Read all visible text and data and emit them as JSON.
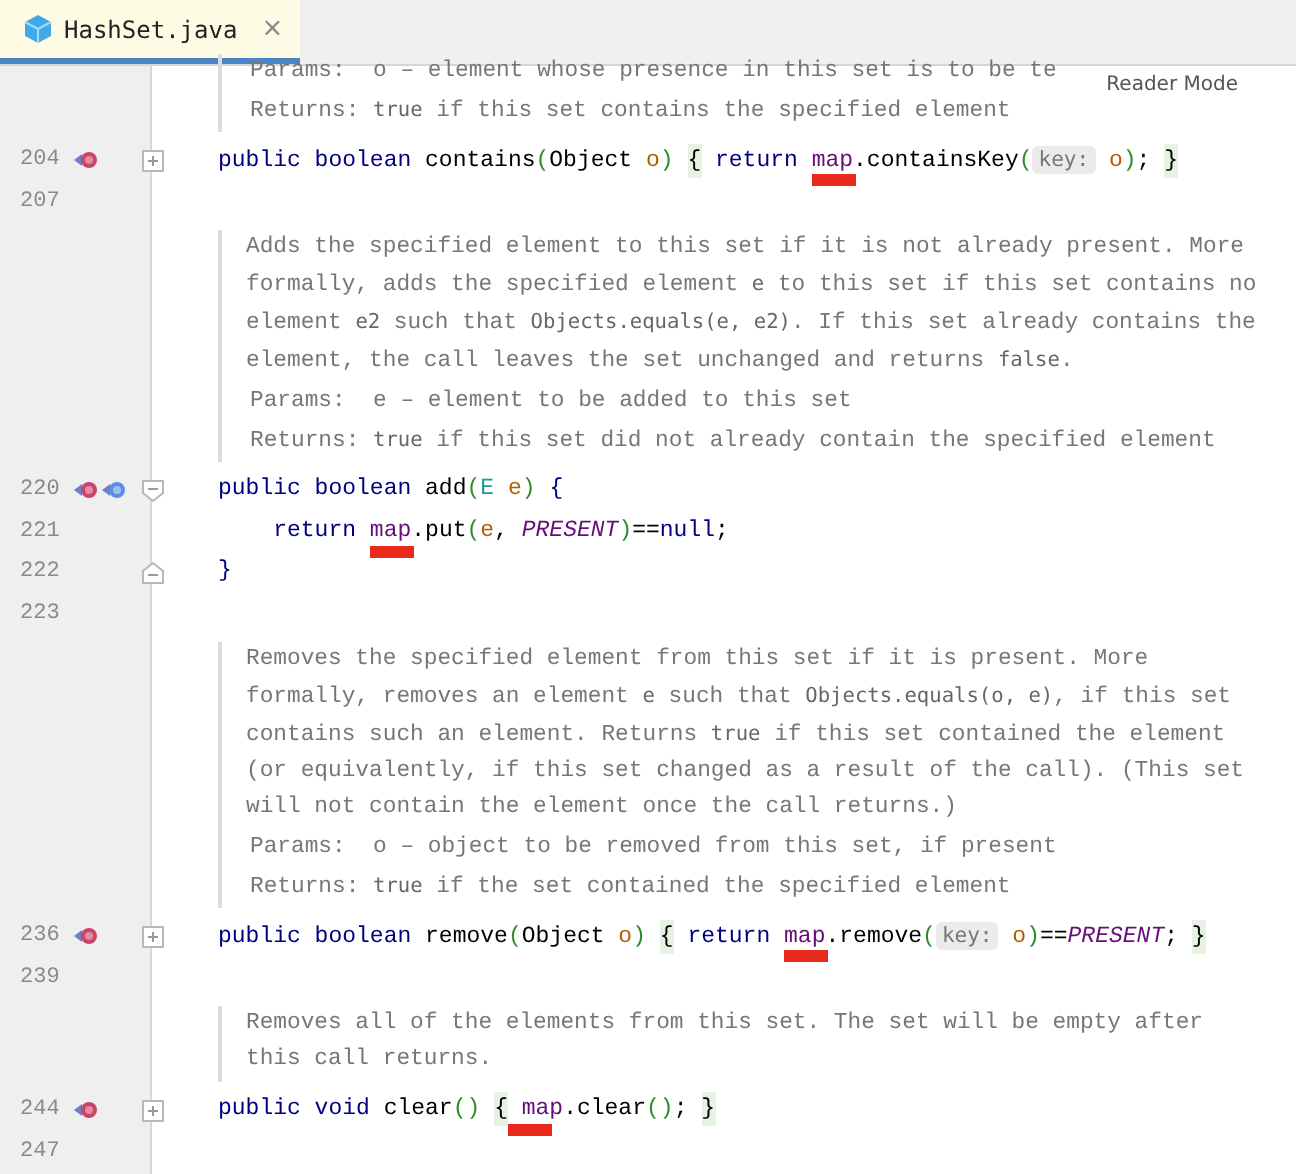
{
  "tab": {
    "title": "HashSet.java",
    "close": "×",
    "selected": true
  },
  "reader_mode": "Reader Mode",
  "rows": [
    {
      "kind": "doc",
      "lines": [],
      "tags": [
        {
          "label": "Params:",
          "segments": [
            {
              "t": " o – element whose presence in this set is to be te"
            }
          ]
        },
        {
          "label": "Returns:",
          "segments": [
            {
              "t": "true",
              "code": true
            },
            {
              "t": " if this set contains the specified element"
            }
          ]
        }
      ]
    },
    {
      "kind": "code",
      "number": "204",
      "icons": [
        {
          "kind": "overrides"
        }
      ],
      "fold_marker": {
        "kind": "collapsed"
      },
      "tokens": [
        {
          "t": "public boolean ",
          "color": "#000080"
        },
        {
          "t": "contains",
          "color": "#000000"
        },
        {
          "t": "(",
          "color": "#2f8c2f"
        },
        {
          "t": "Object ",
          "color": "#000000"
        },
        {
          "t": "o",
          "color": "#b35c00"
        },
        {
          "t": ") ",
          "color": "#2f8c2f"
        },
        {
          "t": "{",
          "kind": "fold"
        },
        {
          "t": " return ",
          "color": "#000080"
        },
        {
          "t": "map",
          "color": "#660e7a",
          "marked": true
        },
        {
          "t": ".containsKey",
          "color": "#000000"
        },
        {
          "t": "(",
          "color": "#2f8c2f"
        },
        {
          "t": "key:",
          "kind": "hint"
        },
        {
          "t": " o",
          "color": "#b35c00"
        },
        {
          "t": ")",
          "color": "#2f8c2f"
        },
        {
          "t": "; ",
          "color": "#000000"
        },
        {
          "t": "}",
          "kind": "fold"
        }
      ]
    },
    {
      "kind": "code",
      "number": "207"
    },
    {
      "kind": "doc",
      "lines": [
        [
          {
            "t": "Adds the specified element to this set if it is not already present. More"
          }
        ],
        [
          {
            "t": "formally, adds the specified element "
          },
          {
            "t": "e",
            "code": true
          },
          {
            "t": " to this set if this set contains no"
          }
        ],
        [
          {
            "t": "element "
          },
          {
            "t": "e2",
            "code": true
          },
          {
            "t": " such that "
          },
          {
            "t": "Objects.equals(e, e2)",
            "code": true
          },
          {
            "t": ". If this set already contains the"
          }
        ],
        [
          {
            "t": "element, the call leaves the set unchanged and returns "
          },
          {
            "t": "false",
            "code": true
          },
          {
            "t": "."
          }
        ]
      ],
      "tags": [
        {
          "label": "Params:",
          "segments": [
            {
              "t": " e – element to be added to this set"
            }
          ]
        },
        {
          "label": "Returns:",
          "segments": [
            {
              "t": "true",
              "code": true
            },
            {
              "t": " if this set did not already contain the specified element"
            }
          ]
        }
      ]
    },
    {
      "kind": "code",
      "number": "220",
      "icons": [
        {
          "kind": "overrides"
        },
        {
          "kind": "overridden"
        }
      ],
      "fold_marker": {
        "kind": "expanded"
      },
      "tokens": [
        {
          "t": "public boolean ",
          "color": "#000080"
        },
        {
          "t": "add",
          "color": "#000000"
        },
        {
          "t": "(",
          "color": "#2f8c2f"
        },
        {
          "t": "E ",
          "color": "#20999d"
        },
        {
          "t": "e",
          "color": "#b35c00"
        },
        {
          "t": ") ",
          "color": "#2f8c2f"
        },
        {
          "t": "{",
          "color": "#000080"
        }
      ]
    },
    {
      "kind": "code",
      "number": "221",
      "tokens": [
        {
          "t": "    return ",
          "color": "#000080"
        },
        {
          "t": "map",
          "color": "#660e7a",
          "marked": true
        },
        {
          "t": ".put",
          "color": "#000000"
        },
        {
          "t": "(",
          "color": "#2f8c2f"
        },
        {
          "t": "e",
          "color": "#b35c00"
        },
        {
          "t": ", ",
          "color": "#000000"
        },
        {
          "t": "PRESENT",
          "color": "#660e7a",
          "italic": true
        },
        {
          "t": ")",
          "color": "#2f8c2f"
        },
        {
          "t": "==",
          "color": "#000000"
        },
        {
          "t": "null",
          "color": "#000080"
        },
        {
          "t": ";",
          "color": "#000000"
        }
      ]
    },
    {
      "kind": "code",
      "number": "222",
      "fold_marker": {
        "kind": "end"
      },
      "tokens": [
        {
          "t": "}",
          "color": "#000080"
        }
      ]
    },
    {
      "kind": "code",
      "number": "223"
    },
    {
      "kind": "doc",
      "lines": [
        [
          {
            "t": "Removes the specified element from this set if it is present. More"
          }
        ],
        [
          {
            "t": "formally, removes an element "
          },
          {
            "t": "e",
            "code": true
          },
          {
            "t": " such that "
          },
          {
            "t": "Objects.equals(o, e)",
            "code": true
          },
          {
            "t": ", if this set"
          }
        ],
        [
          {
            "t": "contains such an element. Returns "
          },
          {
            "t": "true",
            "code": true
          },
          {
            "t": " if this set contained the element"
          }
        ],
        [
          {
            "t": "(or equivalently, if this set changed as a result of the call). (This set"
          }
        ],
        [
          {
            "t": "will not contain the element once the call returns.)"
          }
        ]
      ],
      "tags": [
        {
          "label": "Params:",
          "segments": [
            {
              "t": " o – object to be removed from this set, if present"
            }
          ]
        },
        {
          "label": "Returns:",
          "segments": [
            {
              "t": "true",
              "code": true
            },
            {
              "t": " if the set contained the specified element"
            }
          ]
        }
      ]
    },
    {
      "kind": "code",
      "number": "236",
      "icons": [
        {
          "kind": "overrides"
        }
      ],
      "fold_marker": {
        "kind": "collapsed"
      },
      "tokens": [
        {
          "t": "public boolean ",
          "color": "#000080"
        },
        {
          "t": "remove",
          "color": "#000000"
        },
        {
          "t": "(",
          "color": "#2f8c2f"
        },
        {
          "t": "Object ",
          "color": "#000000"
        },
        {
          "t": "o",
          "color": "#b35c00"
        },
        {
          "t": ") ",
          "color": "#2f8c2f"
        },
        {
          "t": "{",
          "kind": "fold"
        },
        {
          "t": " return ",
          "color": "#000080"
        },
        {
          "t": "map",
          "color": "#660e7a",
          "marked": true
        },
        {
          "t": ".remove",
          "color": "#000000"
        },
        {
          "t": "(",
          "color": "#2f8c2f"
        },
        {
          "t": "key:",
          "kind": "hint"
        },
        {
          "t": " o",
          "color": "#b35c00"
        },
        {
          "t": ")",
          "color": "#2f8c2f"
        },
        {
          "t": "==",
          "color": "#000000"
        },
        {
          "t": "PRESENT",
          "color": "#660e7a",
          "italic": true
        },
        {
          "t": "; ",
          "color": "#000000"
        },
        {
          "t": "}",
          "kind": "fold"
        }
      ]
    },
    {
      "kind": "code",
      "number": "239"
    },
    {
      "kind": "doc",
      "lines": [
        [
          {
            "t": "Removes all of the elements from this set. The set will be empty after"
          }
        ],
        [
          {
            "t": "this call returns."
          }
        ]
      ],
      "tags": []
    },
    {
      "kind": "code",
      "number": "244",
      "icons": [
        {
          "kind": "overrides"
        }
      ],
      "fold_marker": {
        "kind": "collapsed"
      },
      "tokens": [
        {
          "t": "public void ",
          "color": "#000080"
        },
        {
          "t": "clear",
          "color": "#000000"
        },
        {
          "t": "() ",
          "color": "#2f8c2f"
        },
        {
          "t": "{",
          "kind": "fold"
        },
        {
          "t": " map",
          "color": "#660e7a",
          "marked": true
        },
        {
          "t": ".clear",
          "color": "#000000"
        },
        {
          "t": "()",
          "color": "#2f8c2f"
        },
        {
          "t": "; ",
          "color": "#000000"
        },
        {
          "t": "}",
          "kind": "fold"
        }
      ]
    },
    {
      "kind": "code",
      "number": "247"
    }
  ]
}
